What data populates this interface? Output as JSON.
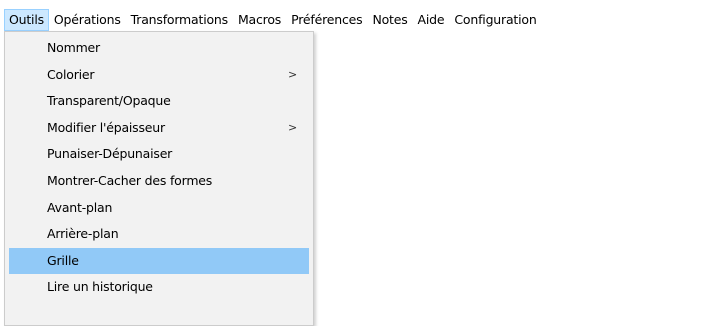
{
  "menubar": {
    "items": [
      {
        "label": "Outils",
        "open": true
      },
      {
        "label": "Opérations"
      },
      {
        "label": "Transformations"
      },
      {
        "label": "Macros"
      },
      {
        "label": "Préférences"
      },
      {
        "label": "Notes"
      },
      {
        "label": "Aide"
      },
      {
        "label": "Configuration"
      }
    ]
  },
  "dropdown": {
    "items": [
      {
        "label": "Nommer",
        "submenu": false
      },
      {
        "label": "Colorier",
        "submenu": true,
        "arrow": ">"
      },
      {
        "label": "Transparent/Opaque",
        "submenu": false
      },
      {
        "label": "Modifier l'épaisseur",
        "submenu": true,
        "arrow": ">"
      },
      {
        "label": "Punaiser-Dépunaiser",
        "submenu": false
      },
      {
        "label": "Montrer-Cacher des formes",
        "submenu": false
      },
      {
        "label": "Avant-plan",
        "submenu": false
      },
      {
        "label": "Arrière-plan",
        "submenu": false
      },
      {
        "label": "Grille",
        "submenu": false,
        "highlighted": true
      },
      {
        "label": "Lire un historique",
        "submenu": false
      }
    ]
  },
  "colors": {
    "open_menu_bg": "#cce8ff",
    "open_menu_border": "#99d1ff",
    "dropdown_bg": "#f2f2f2",
    "highlight_bg": "#91c9f7"
  }
}
